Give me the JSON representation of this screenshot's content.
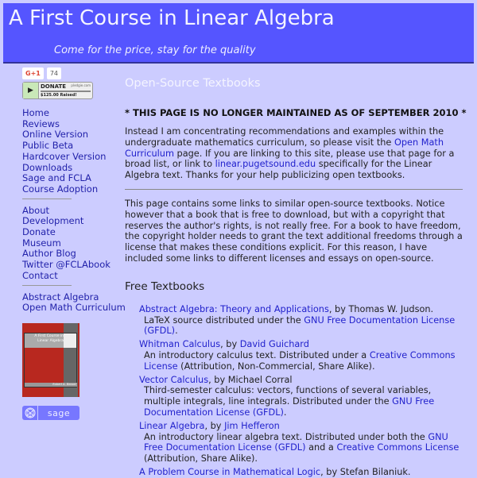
{
  "header": {
    "title": "A First Course in Linear Algebra",
    "tagline": "Come for the price, stay for the quality",
    "bg_color": "#5555ff"
  },
  "sidebar": {
    "gplus": {
      "label": "G+1",
      "count": "74"
    },
    "donate": {
      "label": "DONATE",
      "brand": "pledgie.com",
      "raised": "$125.00 Raised!"
    },
    "nav_primary": [
      {
        "label": "Home"
      },
      {
        "label": "Reviews"
      },
      {
        "label": "Online Version"
      },
      {
        "label": "Public Beta"
      },
      {
        "label": "Hardcover Version"
      },
      {
        "label": "Downloads"
      },
      {
        "label": "Sage and FCLA"
      },
      {
        "label": "Course Adoption"
      }
    ],
    "nav_secondary": [
      {
        "label": "About"
      },
      {
        "label": "Development"
      },
      {
        "label": "Donate"
      },
      {
        "label": "Museum"
      },
      {
        "label": "Author Blog"
      },
      {
        "label": "Twitter @FCLAbook"
      },
      {
        "label": "Contact"
      }
    ],
    "nav_tertiary": [
      {
        "label": "Abstract Algebra"
      },
      {
        "label": "Open Math Curriculum"
      }
    ],
    "cover": {
      "title": "A First Course in Linear Algebra",
      "author": "Robert A. Beezer"
    },
    "sage_logo": "sage"
  },
  "main": {
    "heading": "Open-Source Textbooks",
    "notice": "* THIS PAGE IS NO LONGER MAINTAINED AS OF SEPTEMBER 2010 *",
    "intro": {
      "t1": "Instead I am concentrating recommendations and examples within the undergraduate mathematics curriculum, so please visit the ",
      "link1": "Open Math Curriculum",
      "t2": " page. If you are linking to this site, please use that page for a broad list, or link to ",
      "link2": "linear.pugetsound.edu",
      "t3": " specifically for the Linear Algebra text. Thanks for your help publicizing open textbooks."
    },
    "about": "This page contains some links to similar open-source textbooks. Notice however that a book that is free to download, but with a copyright that reserves the author's rights, is not really free. For a book to have freedom, the copyright holder needs to grant the text additional freedoms through a license that makes these conditions explicit. For this reason, I have included some links to different licenses and essays on open-source.",
    "section_title": "Free Textbooks",
    "books": [
      {
        "title": "Abstract Algebra: Theory and Applications",
        "by": ", by Thomas W. Judson.",
        "desc_pre": "LaTeX source distributed under the ",
        "license": "GNU Free Documentation License (GFDL)",
        "desc_post": "."
      },
      {
        "title": "Whitman Calculus",
        "by": ", by ",
        "author_link": "David Guichard",
        "desc_pre": "An introductory calculus text. Distributed under a ",
        "license": "Creative Commons License",
        "desc_post": " (Attribution, Non-Commercial, Share Alike)."
      },
      {
        "title": "Vector Calculus",
        "by": ", by Michael Corral",
        "desc_pre": "Third-semester calculus: vectors, functions of several variables, multiple integrals, line integrals. Distributed under the ",
        "license": "GNU Free Documentation License (GFDL)",
        "desc_post": "."
      },
      {
        "title": "Linear Algebra",
        "by": ", by ",
        "author_link": "Jim Hefferon",
        "desc_pre": "An introductory linear algebra text. Distributed under both the ",
        "license": "GNU Free Documentation License (GFDL)",
        "desc_mid": " and a ",
        "license2": "Creative Commons License",
        "desc_post": " (Attribution, Share Alike)."
      },
      {
        "title": "A Problem Course in Mathematical Logic",
        "by": ", by Stefan Bilaniuk."
      }
    ]
  }
}
